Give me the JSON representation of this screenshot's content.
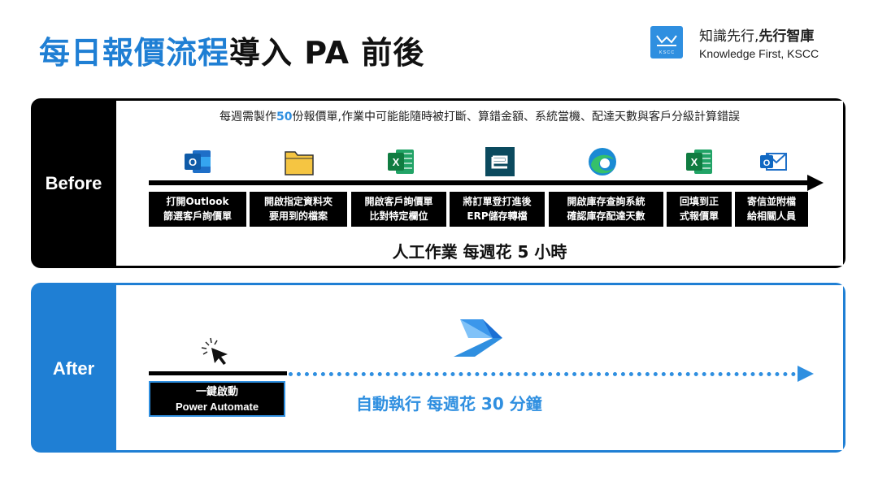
{
  "header": {
    "title_highlight": "每日報價流程",
    "title_rest": "導入 PA 前後"
  },
  "brand": {
    "tagline_regular": "知識先行,",
    "tagline_bold": "先行智庫",
    "subtitle": "Knowledge First, KSCC",
    "logo_icon": "kscc-logo-icon",
    "logo_text": "K S C C"
  },
  "before": {
    "label": "Before",
    "description_pre": "每週需製作",
    "description_count": "50",
    "description_post": "份報價單,作業中可能能隨時被打斷、算錯金額、系統當機、配達天數與客戶分級計算錯誤",
    "steps": [
      {
        "icon": "outlook-icon",
        "line1": "打開Outlook",
        "line2": "篩選客戶詢價單"
      },
      {
        "icon": "folder-icon",
        "line1": "開啟指定資料夾",
        "line2": "要用到的檔案"
      },
      {
        "icon": "excel-icon",
        "line1": "開啟客戶詢價單",
        "line2": "比對特定欄位"
      },
      {
        "icon": "erp-icon",
        "line1": "將訂單登打進後",
        "line2": "ERP儲存轉檔"
      },
      {
        "icon": "edge-browser-icon",
        "line1": "開啟庫存查詢系統",
        "line2": "確認庫存配達天數"
      },
      {
        "icon": "excel-icon",
        "line1": "回填到正",
        "line2": "式報價單"
      },
      {
        "icon": "mail-icon",
        "line1": "寄信並附檔",
        "line2": "給相關人員"
      }
    ],
    "summary": "人工作業 每週花 5 小時"
  },
  "after": {
    "label": "After",
    "trigger_line1": "一鍵啟動",
    "trigger_line2": "Power Automate",
    "summary": "自動執行 每週花 30 分鐘",
    "cursor_icon": "click-cursor-icon",
    "automate_icon": "power-automate-icon"
  },
  "colors": {
    "accent_blue": "#1f7fd4",
    "light_blue": "#2f8fe0",
    "dark": "#000000"
  }
}
